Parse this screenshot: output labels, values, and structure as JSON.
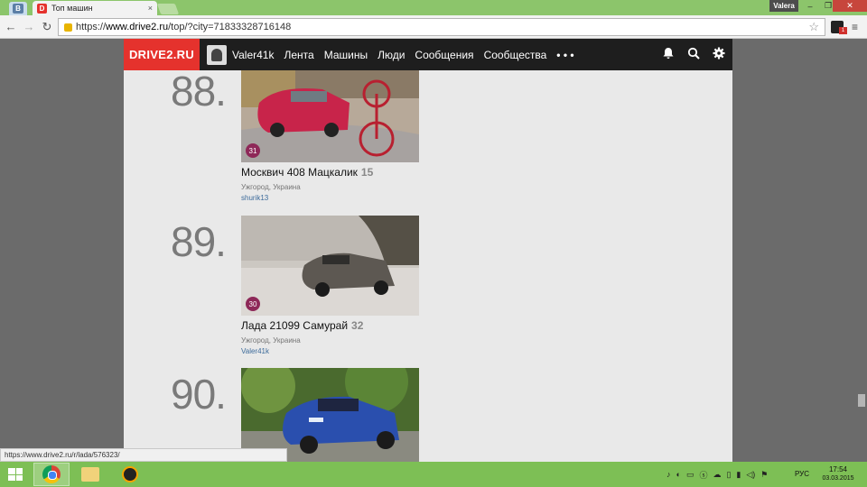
{
  "browser": {
    "tab_vk_label": "B",
    "tab_title": "Топ машин",
    "tab_favicon": "D",
    "tab_close": "×",
    "user_label": "Valera",
    "win_min": "–",
    "win_max": "❐",
    "win_close": "✕",
    "url_prefix": "https://",
    "url_host": "www.drive2.ru",
    "url_path": "/top/?city=71833328716148",
    "ext_badge": "1",
    "status_url": "https://www.drive2.ru/r/lada/576323/"
  },
  "site": {
    "logo": "DRIVE2.RU",
    "username": "Valer41k",
    "nav": [
      "Лента",
      "Машины",
      "Люди",
      "Сообщения",
      "Сообщества",
      "• • •"
    ],
    "icons": [
      "bell-icon",
      "search-icon",
      "gear-icon"
    ]
  },
  "entries": [
    {
      "rank": "88.",
      "photos": "31",
      "title": "Москвич 408 Мацкалик",
      "count": "15",
      "location": "Ужгород, Украина",
      "owner": "shurik13"
    },
    {
      "rank": "89.",
      "photos": "30",
      "title": "Лада 21099 Самурай",
      "count": "32",
      "location": "Ужгород, Украина",
      "owner": "Valer41k"
    },
    {
      "rank": "90.",
      "photos": "",
      "title": "",
      "count": "",
      "location": "",
      "owner": ""
    }
  ],
  "taskbar": {
    "lang": "РУС",
    "time": "17:54",
    "date": "03.03.2015"
  }
}
